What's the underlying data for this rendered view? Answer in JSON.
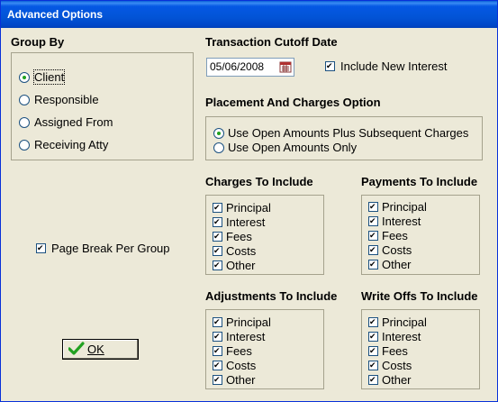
{
  "window": {
    "title": "Advanced Options"
  },
  "group_by": {
    "header": "Group By",
    "options": [
      "Client",
      "Responsible",
      "Assigned From",
      "Receiving Atty"
    ],
    "selected": "Client"
  },
  "page_break": {
    "label": "Page Break Per Group",
    "checked": true
  },
  "cutoff": {
    "header": "Transaction Cutoff Date",
    "date": "05/06/2008",
    "include_new_interest_label": "Include New Interest",
    "include_new_interest_checked": true
  },
  "placement": {
    "header": "Placement And Charges Option",
    "options": [
      "Use Open Amounts Plus Subsequent Charges",
      "Use Open Amounts Only"
    ],
    "selected": "Use Open Amounts Plus Subsequent Charges"
  },
  "charges": {
    "header": "Charges To Include",
    "items": [
      "Principal",
      "Interest",
      "Fees",
      "Costs",
      "Other"
    ]
  },
  "payments": {
    "header": "Payments To Include",
    "items": [
      "Principal",
      "Interest",
      "Fees",
      "Costs",
      "Other"
    ]
  },
  "adjustments": {
    "header": "Adjustments To Include",
    "items": [
      "Principal",
      "Interest",
      "Fees",
      "Costs",
      "Other"
    ]
  },
  "writeoffs": {
    "header": "Write Offs To Include",
    "items": [
      "Principal",
      "Interest",
      "Fees",
      "Costs",
      "Other"
    ]
  },
  "ok_button": {
    "label": "OK",
    "icon": "checkmark-icon"
  },
  "colors": {
    "title_bar": "#0054E3",
    "face": "#ECE9D8",
    "check_green": "#21A121"
  }
}
